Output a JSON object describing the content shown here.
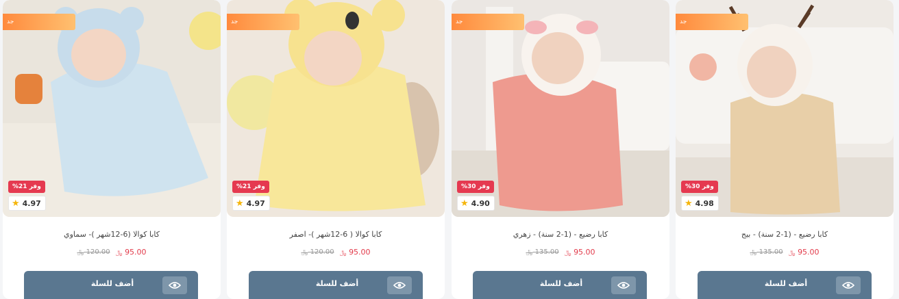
{
  "products": [
    {
      "title": "كابا كوالا (6-12شهر )- سماوي",
      "price": "95.00",
      "old_price": "120.00",
      "currency": "﷼",
      "save_badge": "وفر 21%",
      "rating": "4.97",
      "ribbon": "جد",
      "add_to_cart": "أضف للسلة",
      "image": "baby-blue-koala-towel",
      "bg": "#e9e6df",
      "garment": "#cfe3ef"
    },
    {
      "title": "كابا كوالا ( 6-12شهر )- اصفر",
      "price": "95.00",
      "old_price": "120.00",
      "currency": "﷼",
      "save_badge": "وفر 21%",
      "rating": "4.97",
      "ribbon": "جد",
      "add_to_cart": "أضف للسلة",
      "image": "baby-yellow-koala-towel",
      "bg": "#efe8df",
      "garment": "#f8e79a"
    },
    {
      "title": "كابا رضيع - (1-2 سنة) - زهري",
      "price": "95.00",
      "old_price": "135.00",
      "currency": "﷼",
      "save_badge": "وفر 30%",
      "rating": "4.90",
      "ribbon": "جد",
      "add_to_cart": "أضف للسلة",
      "image": "baby-pink-deer-towel",
      "bg": "#ece8e4",
      "garment": "#ee9a8f"
    },
    {
      "title": "كابا رضيع - (1-2 سنة) - بيج",
      "price": "95.00",
      "old_price": "135.00",
      "currency": "﷼",
      "save_badge": "وفر 30%",
      "rating": "4.98",
      "ribbon": "جد",
      "add_to_cart": "أضف للسلة",
      "image": "baby-beige-deer-towel",
      "bg": "#efebe6",
      "garment": "#e8cfa8"
    }
  ],
  "colors": {
    "accent": "#5a7790",
    "price": "#e23a4a",
    "badge": "#e53950",
    "star": "#f5b50a"
  }
}
